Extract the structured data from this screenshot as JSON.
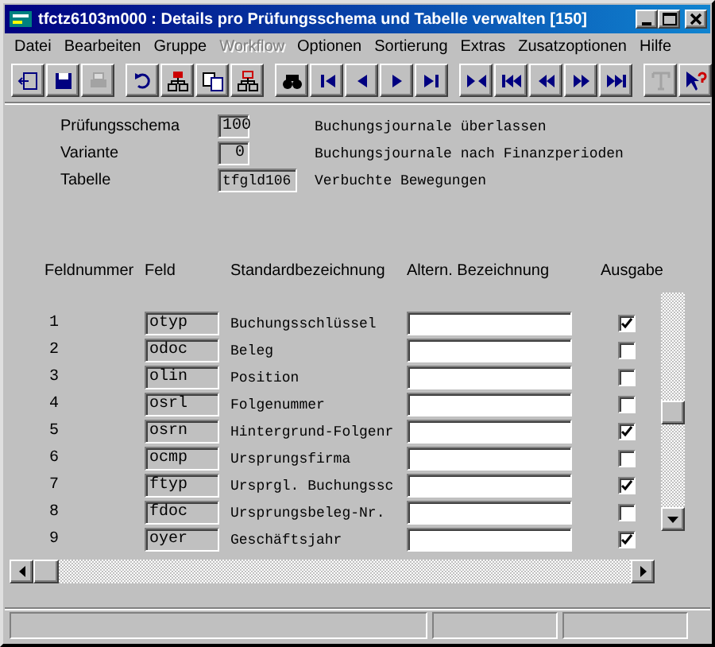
{
  "window": {
    "title": "tfctz6103m000 : Details pro Prüfungsschema und Tabelle verwalten [150]"
  },
  "menu": [
    {
      "label": "Datei",
      "disabled": false
    },
    {
      "label": "Bearbeiten",
      "disabled": false
    },
    {
      "label": "Gruppe",
      "disabled": false
    },
    {
      "label": "Workflow",
      "disabled": true
    },
    {
      "label": "Optionen",
      "disabled": false
    },
    {
      "label": "Sortierung",
      "disabled": false
    },
    {
      "label": "Extras",
      "disabled": false
    },
    {
      "label": "Zusatzoptionen",
      "disabled": false
    },
    {
      "label": "Hilfe",
      "disabled": false
    }
  ],
  "toolbar": [
    [
      {
        "kind": "exit",
        "disabled": false
      },
      {
        "kind": "save",
        "disabled": false
      },
      {
        "kind": "print",
        "disabled": true
      }
    ],
    [
      {
        "kind": "undo",
        "disabled": false
      },
      {
        "kind": "insert",
        "disabled": false
      },
      {
        "kind": "copy",
        "disabled": false
      },
      {
        "kind": "delete",
        "disabled": false
      }
    ],
    [
      {
        "kind": "find",
        "disabled": false
      },
      {
        "kind": "first",
        "disabled": false
      },
      {
        "kind": "prev",
        "disabled": false
      },
      {
        "kind": "next",
        "disabled": false
      },
      {
        "kind": "last",
        "disabled": false
      }
    ],
    [
      {
        "kind": "group",
        "disabled": false
      },
      {
        "kind": "first-set",
        "disabled": false
      },
      {
        "kind": "prev-set",
        "disabled": false
      },
      {
        "kind": "next-set",
        "disabled": false
      },
      {
        "kind": "last-set",
        "disabled": false
      }
    ],
    [
      {
        "kind": "text",
        "disabled": true
      },
      {
        "kind": "help",
        "disabled": false
      }
    ]
  ],
  "header_fields": [
    {
      "label": "Prüfungsschema",
      "value": "100",
      "description": "Buchungsjournale überlassen",
      "kind": "number"
    },
    {
      "label": "Variante",
      "value": "0",
      "description": "Buchungsjournale nach Finanzperioden",
      "kind": "number"
    },
    {
      "label": "Tabelle",
      "value": "tfgld106",
      "description": "Verbuchte Bewegungen",
      "kind": "text"
    }
  ],
  "table": {
    "columns": [
      "Feldnummer",
      "Feld",
      "Standardbezeichnung",
      "Altern. Bezeichnung",
      "Ausgabe"
    ],
    "rows": [
      {
        "number": "1",
        "field": "otyp",
        "standard": "Buchungsschlüssel",
        "checked": true
      },
      {
        "number": "2",
        "field": "odoc",
        "standard": "Beleg",
        "checked": false
      },
      {
        "number": "3",
        "field": "olin",
        "standard": "Position",
        "checked": false
      },
      {
        "number": "4",
        "field": "osrl",
        "standard": "Folgenummer",
        "checked": false
      },
      {
        "number": "5",
        "field": "osrn",
        "standard": "Hintergrund-Folgenr",
        "checked": true
      },
      {
        "number": "6",
        "field": "ocmp",
        "standard": "Ursprungsfirma",
        "checked": false
      },
      {
        "number": "7",
        "field": "ftyp",
        "standard": "Ursprgl. Buchungssc",
        "checked": true
      },
      {
        "number": "8",
        "field": "fdoc",
        "standard": "Ursprungsbeleg-Nr.",
        "checked": false
      },
      {
        "number": "9",
        "field": "oyer",
        "standard": "Geschäftsjahr",
        "checked": true
      }
    ]
  }
}
